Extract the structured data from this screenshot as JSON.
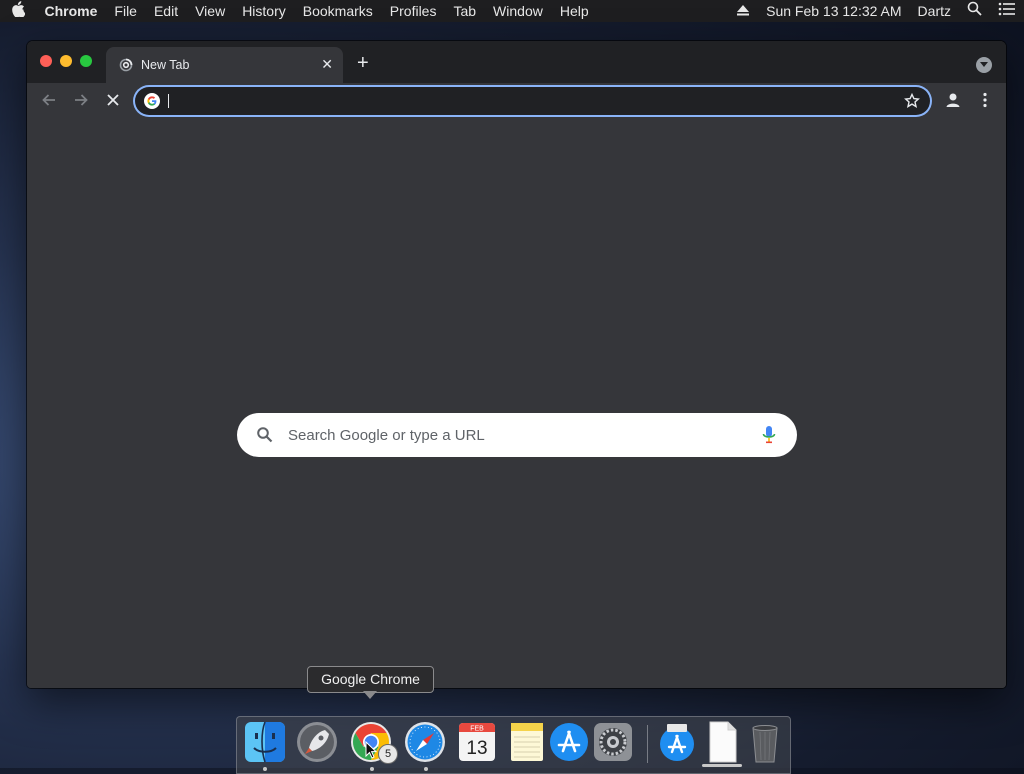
{
  "menubar": {
    "app_name": "Chrome",
    "items": [
      "File",
      "Edit",
      "View",
      "History",
      "Bookmarks",
      "Profiles",
      "Tab",
      "Window",
      "Help"
    ],
    "datetime": "Sun Feb 13  12:32 AM",
    "user": "Dartz"
  },
  "browser": {
    "tab_title": "New Tab",
    "omnibox_value": "",
    "search_placeholder": "Search Google or type a URL"
  },
  "dock": {
    "tooltip": "Google Chrome",
    "chrome_badge": "5",
    "calendar_month": "FEB",
    "calendar_day": "13",
    "apps": [
      "Finder",
      "Launchpad",
      "Google Chrome",
      "Safari",
      "Calendar",
      "Notes",
      "App Store",
      "System Preferences",
      "Downloads",
      "Document",
      "Trash"
    ]
  },
  "colors": {
    "accent_focus": "#8ab4f8",
    "window_bg": "#35363a",
    "tabstrip_bg": "#202124"
  }
}
